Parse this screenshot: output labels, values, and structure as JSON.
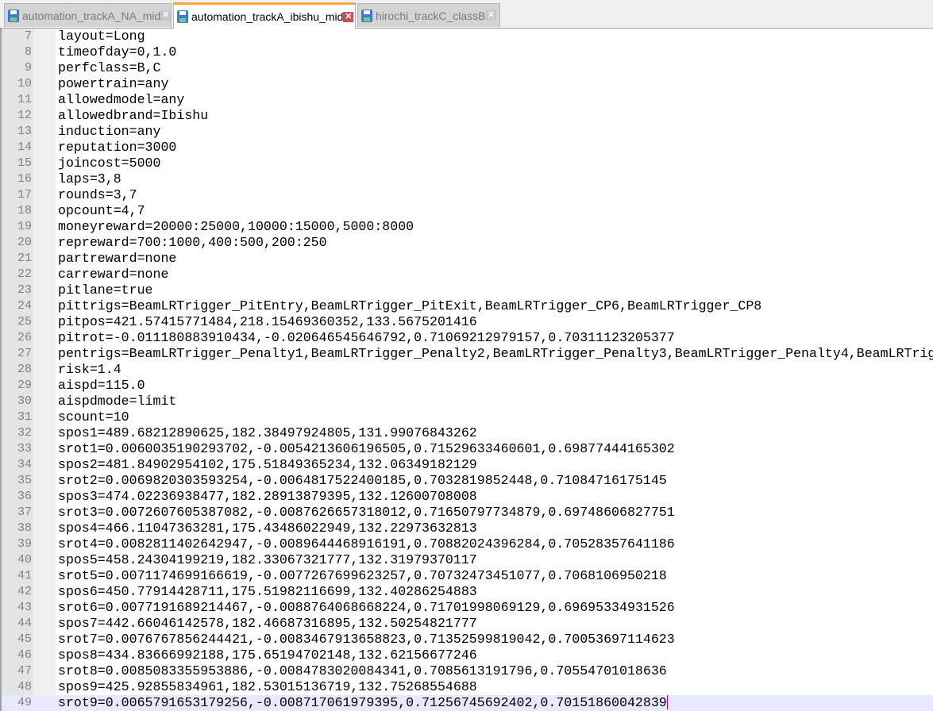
{
  "tabs": [
    {
      "label": "automation_trackA_NA_mid",
      "active": false,
      "icon": "save-icon"
    },
    {
      "label": "automation_trackA_ibishu_mid",
      "active": true,
      "icon": "save-icon"
    },
    {
      "label": "hirochi_trackC_classB",
      "active": false,
      "icon": "save-icon"
    }
  ],
  "colors": {
    "active_tab_accent": "#f9a53c",
    "current_line": "#e8e8ff",
    "caret": "#8000ff"
  },
  "editor": {
    "current_line": 49,
    "lines": [
      {
        "num": "7",
        "text": "layout=Long"
      },
      {
        "num": "8",
        "text": "timeofday=0,1.0"
      },
      {
        "num": "9",
        "text": "perfclass=B,C"
      },
      {
        "num": "10",
        "text": "powertrain=any"
      },
      {
        "num": "11",
        "text": "allowedmodel=any"
      },
      {
        "num": "12",
        "text": "allowedbrand=Ibishu"
      },
      {
        "num": "13",
        "text": "induction=any"
      },
      {
        "num": "14",
        "text": "reputation=3000"
      },
      {
        "num": "15",
        "text": "joincost=5000"
      },
      {
        "num": "16",
        "text": "laps=3,8"
      },
      {
        "num": "17",
        "text": "rounds=3,7"
      },
      {
        "num": "18",
        "text": "opcount=4,7"
      },
      {
        "num": "19",
        "text": "moneyreward=20000:25000,10000:15000,5000:8000"
      },
      {
        "num": "20",
        "text": "repreward=700:1000,400:500,200:250"
      },
      {
        "num": "21",
        "text": "partreward=none"
      },
      {
        "num": "22",
        "text": "carreward=none"
      },
      {
        "num": "23",
        "text": "pitlane=true"
      },
      {
        "num": "24",
        "text": "pittrigs=BeamLRTrigger_PitEntry,BeamLRTrigger_PitExit,BeamLRTrigger_CP6,BeamLRTrigger_CP8"
      },
      {
        "num": "25",
        "text": "pitpos=421.57415771484,218.15469360352,133.5675201416"
      },
      {
        "num": "26",
        "text": "pitrot=-0.011180883910434,-0.020646545646792,0.71069212979157,0.70311123205377"
      },
      {
        "num": "27",
        "text": "pentrigs=BeamLRTrigger_Penalty1,BeamLRTrigger_Penalty2,BeamLRTrigger_Penalty3,BeamLRTrigger_Penalty4,BeamLRTrig"
      },
      {
        "num": "28",
        "text": "risk=1.4"
      },
      {
        "num": "29",
        "text": "aispd=115.0"
      },
      {
        "num": "30",
        "text": "aispdmode=limit"
      },
      {
        "num": "31",
        "text": "scount=10"
      },
      {
        "num": "32",
        "text": "spos1=489.68212890625,182.38497924805,131.99076843262"
      },
      {
        "num": "33",
        "text": "srot1=0.0060035190293702,-0.0054213606196505,0.71529633460601,0.69877444165302"
      },
      {
        "num": "34",
        "text": "spos2=481.84902954102,175.51849365234,132.06349182129"
      },
      {
        "num": "35",
        "text": "srot2=0.0069820303593254,-0.0064817522400185,0.7032819852448,0.71084716175145"
      },
      {
        "num": "36",
        "text": "spos3=474.02236938477,182.28913879395,132.12600708008"
      },
      {
        "num": "37",
        "text": "srot3=0.0072607605387082,-0.0087626657318012,0.71650797734879,0.69748606827751"
      },
      {
        "num": "38",
        "text": "spos4=466.11047363281,175.43486022949,132.22973632813"
      },
      {
        "num": "39",
        "text": "srot4=0.0082811402642947,-0.0089644468916191,0.70882024396284,0.70528357641186"
      },
      {
        "num": "40",
        "text": "spos5=458.24304199219,182.33067321777,132.31979370117"
      },
      {
        "num": "41",
        "text": "srot5=0.0071174699166619,-0.0077267699623257,0.70732473451077,0.7068106950218"
      },
      {
        "num": "42",
        "text": "spos6=450.77914428711,175.51982116699,132.40286254883"
      },
      {
        "num": "43",
        "text": "srot6=0.0077191689214467,-0.0088764068668224,0.71701998069129,0.69695334931526"
      },
      {
        "num": "44",
        "text": "spos7=442.66046142578,182.46687316895,132.50254821777"
      },
      {
        "num": "45",
        "text": "srot7=0.0076767856244421,-0.0083467913658823,0.71352599819042,0.70053697114623"
      },
      {
        "num": "46",
        "text": "spos8=434.83666992188,175.65194702148,132.62156677246"
      },
      {
        "num": "47",
        "text": "srot8=0.0085083355953886,-0.0084783020084341,0.7085613191796,0.70554701018636"
      },
      {
        "num": "48",
        "text": "spos9=425.92855834961,182.53015136719,132.75268554688"
      },
      {
        "num": "49",
        "text": "srot9=0.0065791653179256,-0.008717061979395,0.71256745692402,0.70151860042839"
      }
    ]
  }
}
